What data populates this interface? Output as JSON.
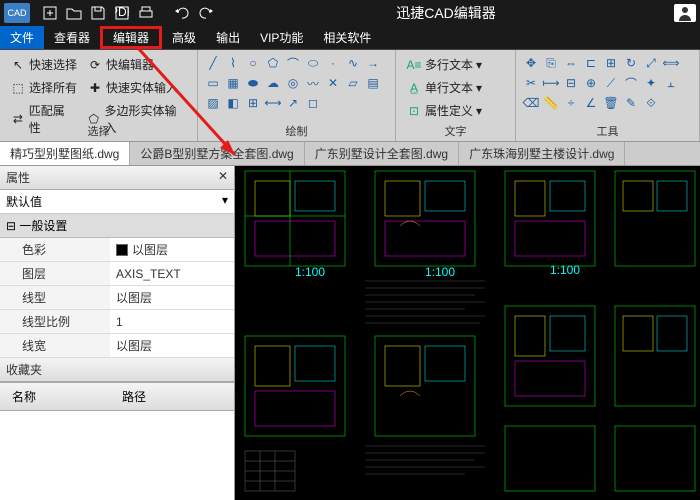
{
  "titlebar": {
    "app_title": "迅捷CAD编辑器"
  },
  "menu": {
    "file": "文件",
    "viewer": "查看器",
    "editor": "编辑器",
    "advanced": "高级",
    "output": "输出",
    "vip": "VIP功能",
    "related": "相关软件"
  },
  "ribbon": {
    "select_group": "选择",
    "quick_select": "快速选择",
    "quick_editor": "快编辑器",
    "select_all": "选择所有",
    "quick_entity": "快速实体输入",
    "match_props": "匹配属性",
    "polygon_entity": "多边形实体输入",
    "draw_group": "绘制",
    "text_group": "文字",
    "multiline_text": "多行文本",
    "single_text": "单行文本",
    "attr_def": "属性定义",
    "tools_group": "工具"
  },
  "tabs": {
    "t1": "精巧型别墅图纸.dwg",
    "t2": "公爵B型别墅方案全套图.dwg",
    "t3": "广东别墅设计全套图.dwg",
    "t4": "广东珠海别墅主楼设计.dwg"
  },
  "props": {
    "panel_title": "属性",
    "default_value": "默认值",
    "general_section": "一般设置",
    "color_label": "色彩",
    "color_value": "以图层",
    "layer_label": "图层",
    "layer_value": "AXIS_TEXT",
    "linetype_label": "线型",
    "linetype_value": "以图层",
    "linescale_label": "线型比例",
    "linescale_value": "1",
    "lineweight_label": "线宽",
    "lineweight_value": "以图层",
    "favorites": "收藏夹",
    "name_col": "名称",
    "path_col": "路径"
  }
}
